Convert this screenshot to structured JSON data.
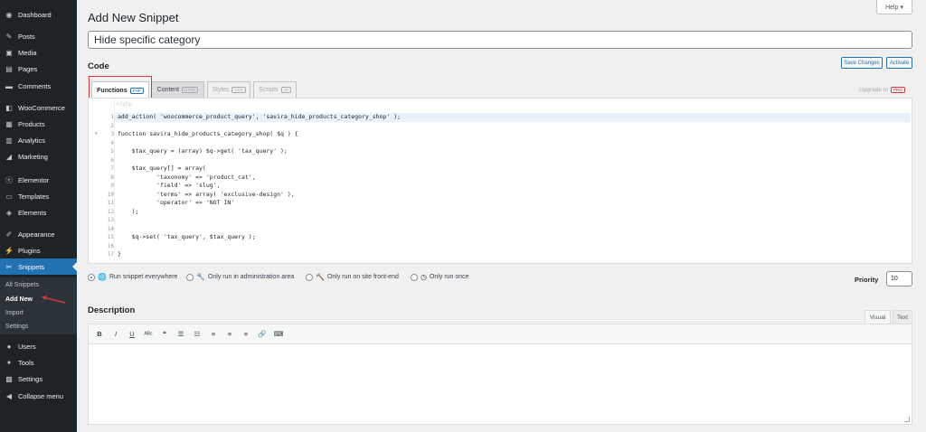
{
  "sidebar": {
    "items": [
      {
        "label": "Dashboard",
        "icon": "dashboard-icon",
        "glyph": "◉"
      },
      {
        "label": "Posts",
        "icon": "pin-icon",
        "glyph": "✎"
      },
      {
        "label": "Media",
        "icon": "media-icon",
        "glyph": "▣"
      },
      {
        "label": "Pages",
        "icon": "pages-icon",
        "glyph": "▤"
      },
      {
        "label": "Comments",
        "icon": "comments-icon",
        "glyph": "▬"
      },
      {
        "label": "WooCommerce",
        "icon": "woo-icon",
        "glyph": "◧"
      },
      {
        "label": "Products",
        "icon": "products-icon",
        "glyph": "▦"
      },
      {
        "label": "Analytics",
        "icon": "analytics-icon",
        "glyph": "▥"
      },
      {
        "label": "Marketing",
        "icon": "megaphone-icon",
        "glyph": "◢"
      },
      {
        "label": "Elementor",
        "icon": "elementor-icon",
        "glyph": "ⓔ"
      },
      {
        "label": "Templates",
        "icon": "folder-icon",
        "glyph": "▭"
      },
      {
        "label": "Elements",
        "icon": "stack-icon",
        "glyph": "◈"
      },
      {
        "label": "Appearance",
        "icon": "brush-icon",
        "glyph": "✐"
      },
      {
        "label": "Plugins",
        "icon": "plug-icon",
        "glyph": "⚡"
      },
      {
        "label": "Snippets",
        "icon": "scissors-icon",
        "glyph": "✂"
      },
      {
        "label": "Users",
        "icon": "users-icon",
        "glyph": "●"
      },
      {
        "label": "Tools",
        "icon": "wrench-icon",
        "glyph": "✦"
      },
      {
        "label": "Settings",
        "icon": "settings-icon",
        "glyph": "▩"
      },
      {
        "label": "Collapse menu",
        "icon": "collapse-icon",
        "glyph": "◀"
      }
    ],
    "submenu": [
      "All Snippets",
      "Add New",
      "Import",
      "Settings"
    ]
  },
  "header": {
    "title": "Add New Snippet",
    "help": "Help ▾"
  },
  "snippet": {
    "title_value": "Hide specific category",
    "code_label": "Code",
    "save_changes": "Save Changes",
    "activate": "Activate"
  },
  "tabs": [
    {
      "label": "Functions",
      "badge": "PHP"
    },
    {
      "label": "Content",
      "badge": "HTML"
    },
    {
      "label": "Styles",
      "badge": "CSS"
    },
    {
      "label": "Scripts",
      "badge": "JS"
    }
  ],
  "upgrade": {
    "label": "Upgrade to",
    "badge": "PRO"
  },
  "code": {
    "line_numbers": [
      "1",
      "2",
      "3",
      "4",
      "5",
      "6",
      "7",
      "8",
      "9",
      "10",
      "11",
      "12",
      "13",
      "14",
      "15",
      "16",
      "17"
    ],
    "lines": [
      "add_action( 'woocommerce_product_query', 'savira_hide_products_category_shop' );",
      "",
      "function savira_hide_products_category_shop( $q ) {",
      "",
      "    $tax_query = (array) $q->get( 'tax_query' );",
      "",
      "    $tax_query[] = array(",
      "           'taxonomy' => 'product_cat',",
      "           'field' => 'slug',",
      "           'terms' => array( 'exclusive-design' ),",
      "           'operator' => 'NOT IN'",
      "    );",
      "",
      "",
      "    $q->set( 'tax_query', $tax_query );",
      "",
      "}"
    ]
  },
  "scope": [
    {
      "label": "Run snippet everywhere",
      "icon": "globe-icon",
      "glyph": "🌐",
      "selected": true
    },
    {
      "label": "Only run in administration area",
      "icon": "wrench-icon",
      "glyph": "🔧",
      "selected": false
    },
    {
      "label": "Only run on site front-end",
      "icon": "hammer-icon",
      "glyph": "🔨",
      "selected": false
    },
    {
      "label": "Only run once",
      "icon": "clock-icon",
      "glyph": "◷",
      "selected": false
    }
  ],
  "priority": {
    "label": "Priority",
    "value": "10"
  },
  "description": {
    "label": "Description",
    "visual_tab": "Visual",
    "text_tab": "Text",
    "toolbar": [
      "B",
      "I",
      "U",
      "ᴬᴮᶜ",
      "❝",
      "☰",
      "☷",
      "≡",
      "≡",
      "≡",
      "🔗",
      "⌨"
    ]
  }
}
